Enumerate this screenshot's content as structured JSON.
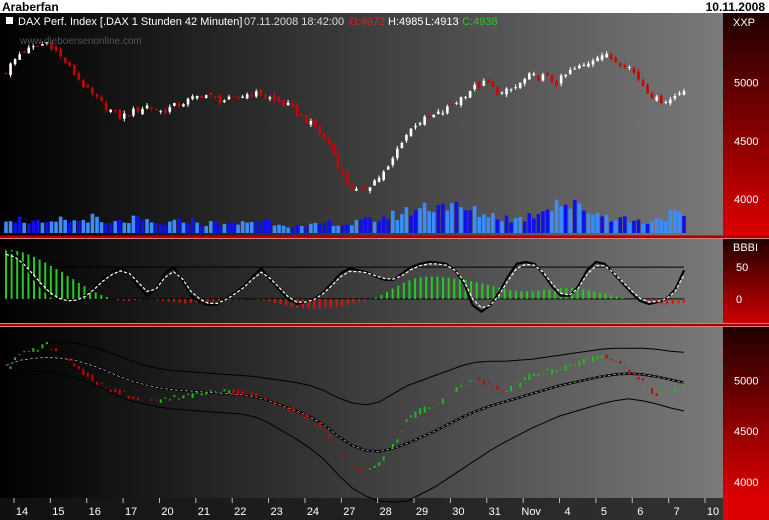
{
  "header": {
    "author": "Araberfan",
    "date": "10.11.2008"
  },
  "colors": {
    "up": "#ffffff",
    "down": "#cc0000",
    "volume": "#1010ee",
    "volume_light": "#3a8cff",
    "osc_pos": "#22cc22",
    "osc_neg": "#dd1111",
    "band_up": "#22bb22",
    "band_down": "#cc0000",
    "scale_bg": "#cc0000",
    "border": "#aa0000"
  },
  "chart_data": [
    {
      "type": "candlestick",
      "title": "DAX Perf. Index [.DAX  1 Stunden 42 Minuten]",
      "timestamp": "07.11.2008 18:42:00",
      "ohlc_labels": {
        "open": "O:4972",
        "high": "H:4985",
        "low": "L:4913",
        "close": "C:4938"
      },
      "watermark": "www.dieboersenonline.com",
      "scale_label": "XXP",
      "ylim": [
        3950,
        5450
      ],
      "yticks": [
        "5000",
        "4500",
        "4000"
      ],
      "ytick_values": [
        5000,
        4500,
        4000
      ],
      "x_labels": [
        "14",
        "15",
        "16",
        "17",
        "20",
        "21",
        "22",
        "23",
        "24",
        "27",
        "28",
        "29",
        "30",
        "31",
        "Nov",
        "4",
        "5",
        "6",
        "7",
        "10"
      ],
      "close_path": [
        5100,
        5250,
        5300,
        5350,
        5200,
        5050,
        4900,
        4800,
        4700,
        4750,
        4800,
        4750,
        4800,
        4850,
        4900,
        4850,
        4850,
        4900,
        4900,
        4850,
        4800,
        4700,
        4600,
        4450,
        4150,
        4050,
        4150,
        4250,
        4500,
        4650,
        4700,
        4750,
        4850,
        4950,
        5000,
        4900,
        4950,
        5050,
        5050,
        5000,
        5100,
        5150,
        5250,
        5200,
        5150,
        5000,
        4850,
        4850,
        4950
      ],
      "volume": [
        6,
        5,
        4,
        3,
        5,
        4,
        6,
        3,
        4,
        5,
        4,
        3,
        4,
        5,
        3,
        4,
        3,
        4,
        5,
        4,
        3,
        2,
        3,
        4,
        3,
        4,
        5,
        6,
        7,
        9,
        10,
        11,
        9,
        8,
        7,
        6,
        5,
        6,
        9,
        12,
        10,
        9,
        7,
        6,
        5,
        4,
        5,
        7,
        6
      ]
    },
    {
      "type": "oscillator",
      "scale_label": "BBBI",
      "ylim": [
        -30,
        80
      ],
      "yticks": [
        "50",
        "0"
      ],
      "ytick_values": [
        50,
        0
      ],
      "reference_levels": [
        50,
        0
      ],
      "histogram": [
        78,
        77,
        75,
        73,
        70,
        66,
        62,
        57,
        52,
        47,
        42,
        36,
        31,
        25,
        20,
        15,
        10,
        6,
        3,
        0,
        -2,
        -3,
        -3,
        -2,
        -1,
        0,
        -1,
        -2,
        -3,
        -4,
        -5,
        -6,
        -7,
        -6,
        -6,
        -5,
        -4,
        -4,
        -3,
        -3,
        -2,
        -1,
        -1,
        0,
        0,
        -1,
        -2,
        -4,
        -6,
        -8,
        -10,
        -12,
        -14,
        -15,
        -16,
        -16,
        -15,
        -14,
        -13,
        -12,
        -11,
        -9,
        -7,
        -5,
        -3,
        -1,
        2,
        6,
        11,
        16,
        21,
        25,
        29,
        32,
        34,
        35,
        35,
        35,
        34,
        33,
        32,
        31,
        30,
        28,
        26,
        24,
        22,
        20,
        18,
        16,
        14,
        13,
        12,
        12,
        12,
        13,
        14,
        15,
        16,
        17,
        17,
        17,
        16,
        15,
        14,
        12,
        10,
        8,
        6,
        4,
        2,
        0,
        -2,
        -4,
        -6,
        -7,
        -8,
        -9,
        -9,
        -8,
        -7,
        -6
      ],
      "stoch": [
        78,
        70,
        55,
        35,
        18,
        5,
        -2,
        -5,
        -3,
        5,
        18,
        32,
        42,
        48,
        40,
        20,
        5,
        15,
        40,
        50,
        30,
        5,
        -5,
        -10,
        -8,
        0,
        10,
        20,
        35,
        48,
        30,
        15,
        0,
        -8,
        -5,
        0,
        10,
        25,
        40,
        48,
        45,
        42,
        35,
        30,
        30,
        40,
        50,
        55,
        58,
        57,
        55,
        45,
        25,
        -10,
        -20,
        -10,
        10,
        35,
        55,
        58,
        55,
        40,
        20,
        5,
        5,
        20,
        45,
        58,
        55,
        40,
        25,
        10,
        -3,
        -8,
        -5,
        0,
        15,
        45
      ],
      "signal": [
        70,
        66,
        55,
        40,
        24,
        10,
        1,
        -3,
        -2,
        4,
        15,
        28,
        38,
        44,
        40,
        26,
        12,
        15,
        33,
        43,
        32,
        12,
        0,
        -7,
        -7,
        -1,
        8,
        18,
        31,
        42,
        32,
        18,
        4,
        -5,
        -5,
        -1,
        8,
        21,
        35,
        43,
        43,
        41,
        36,
        32,
        31,
        37,
        46,
        52,
        55,
        55,
        53,
        45,
        28,
        0,
        -14,
        -10,
        6,
        29,
        48,
        54,
        53,
        42,
        24,
        9,
        6,
        17,
        39,
        52,
        52,
        41,
        27,
        13,
        1,
        -5,
        -4,
        0,
        12,
        38
      ]
    },
    {
      "type": "bollinger",
      "ylim": [
        3900,
        5450
      ],
      "yticks": [
        "5000",
        "4500",
        "4000"
      ],
      "ytick_values": [
        5000,
        4500,
        4000
      ],
      "price": [
        5100,
        5250,
        5300,
        5350,
        5250,
        5150,
        5050,
        4950,
        4900,
        4850,
        4820,
        4800,
        4820,
        4850,
        4880,
        4900,
        4900,
        4880,
        4850,
        4800,
        4750,
        4700,
        4620,
        4520,
        4300,
        4150,
        4100,
        4180,
        4350,
        4600,
        4700,
        4750,
        4850,
        4950,
        5020,
        4950,
        4900,
        4950,
        5050,
        5080,
        5100,
        5150,
        5200,
        5250,
        5200,
        5100,
        5000,
        4850,
        4880,
        4950
      ],
      "upper": [
        5250,
        5320,
        5350,
        5370,
        5380,
        5370,
        5340,
        5300,
        5250,
        5200,
        5150,
        5120,
        5100,
        5090,
        5080,
        5070,
        5060,
        5050,
        5040,
        5020,
        5000,
        4980,
        4950,
        4900,
        4830,
        4780,
        4760,
        4790,
        4870,
        4950,
        5000,
        5050,
        5100,
        5150,
        5180,
        5190,
        5190,
        5200,
        5210,
        5230,
        5250,
        5270,
        5290,
        5310,
        5320,
        5320,
        5320,
        5310,
        5290,
        5280
      ],
      "middle": [
        5150,
        5200,
        5220,
        5230,
        5220,
        5200,
        5160,
        5110,
        5050,
        5000,
        4960,
        4930,
        4910,
        4900,
        4890,
        4880,
        4870,
        4860,
        4840,
        4800,
        4750,
        4700,
        4640,
        4560,
        4450,
        4360,
        4310,
        4300,
        4330,
        4380,
        4440,
        4500,
        4570,
        4640,
        4700,
        4750,
        4790,
        4830,
        4870,
        4910,
        4950,
        4980,
        5010,
        5040,
        5060,
        5070,
        5060,
        5040,
        5010,
        4980
      ],
      "lower": [
        5050,
        5080,
        5090,
        5090,
        5060,
        5030,
        4980,
        4920,
        4850,
        4800,
        4770,
        4740,
        4720,
        4710,
        4700,
        4690,
        4680,
        4670,
        4640,
        4580,
        4500,
        4420,
        4330,
        4220,
        4070,
        3940,
        3860,
        3810,
        3800,
        3810,
        3880,
        3950,
        4040,
        4130,
        4220,
        4310,
        4390,
        4460,
        4530,
        4590,
        4650,
        4690,
        4730,
        4770,
        4800,
        4820,
        4800,
        4770,
        4730,
        4700
      ]
    }
  ]
}
